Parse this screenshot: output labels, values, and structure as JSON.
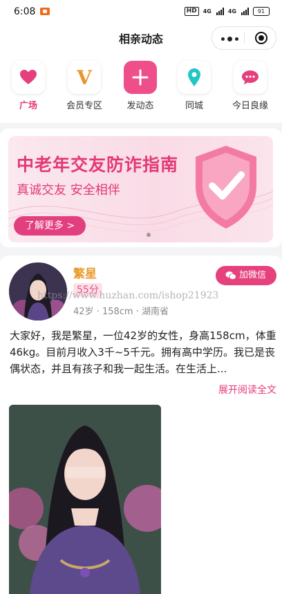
{
  "status_bar": {
    "time": "6:08",
    "network": "4G",
    "battery": "91"
  },
  "header": {
    "title": "相亲动态"
  },
  "nav_items": [
    {
      "label": "广场",
      "icon": "heart-icon",
      "active": true
    },
    {
      "label": "会员专区",
      "icon": "vip-v-icon",
      "active": false
    },
    {
      "label": "发动态",
      "icon": "plus-icon",
      "active": false
    },
    {
      "label": "同城",
      "icon": "location-pin-icon",
      "active": false
    },
    {
      "label": "今日良缘",
      "icon": "chat-bubble-icon",
      "active": false
    }
  ],
  "banner": {
    "title": "中老年交友防诈指南",
    "subtitle": "真诚交友 安全相伴",
    "button_label": "了解更多 >"
  },
  "post": {
    "username": "繁星",
    "score": "55分",
    "info": "42岁 · 158cm · 湖南省",
    "wechat_label": "加微信",
    "watermark": "https://www.huzhan.com/ishop21923",
    "text": "大家好，我是繁星，一位42岁的女性，身高158cm，体重46kg。目前月收入3千~5千元。拥有高中学历。我已是丧偶状态，并且有孩子和我一起生活。在生活上...",
    "read_more": "展开阅读全文"
  },
  "colors": {
    "accent": "#e4397a",
    "username": "#e89a2d",
    "plus_bg": "#ee4f8a",
    "pin": "#22c6c6"
  }
}
